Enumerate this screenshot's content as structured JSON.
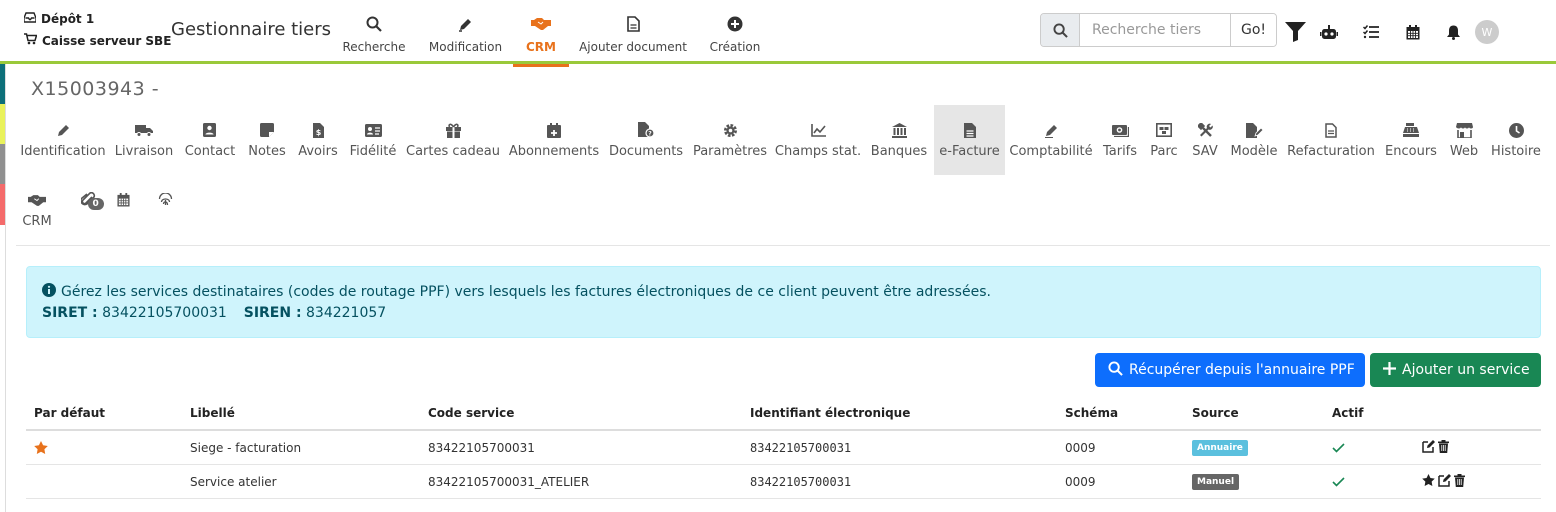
{
  "header": {
    "depot": "Dépôt 1",
    "caisse": "Caisse serveur SBE",
    "app_title": "Gestionnaire tiers",
    "nav": [
      {
        "label": "Recherche",
        "icon": "search-icon"
      },
      {
        "label": "Modification",
        "icon": "pencil-icon"
      },
      {
        "label": "CRM",
        "icon": "handshake-icon",
        "active": true
      },
      {
        "label": "Ajouter document",
        "icon": "file-icon"
      },
      {
        "label": "Création",
        "icon": "plus-circle-icon"
      }
    ],
    "search": {
      "placeholder": "Recherche tiers",
      "go_label": "Go!"
    },
    "avatar_initial": "W"
  },
  "colors": {
    "accent": "#e8721c",
    "topbar_border": "#9ac93a",
    "primary": "#0d6efd",
    "success": "#198754",
    "info_bg": "#cff4fc"
  },
  "record": {
    "title": "X15003943 -"
  },
  "tabs": [
    {
      "label": "Identification",
      "icon": "pencil-icon"
    },
    {
      "label": "Livraison",
      "icon": "truck-icon"
    },
    {
      "label": "Contact",
      "icon": "contact-card-icon"
    },
    {
      "label": "Notes",
      "icon": "sticky-note-icon"
    },
    {
      "label": "Avoirs",
      "icon": "invoice-dollar-icon"
    },
    {
      "label": "Fidélité",
      "icon": "id-card-icon"
    },
    {
      "label": "Cartes cadeau",
      "icon": "gift-icon"
    },
    {
      "label": "Abonnements",
      "icon": "calendar-plus-icon"
    },
    {
      "label": "Documents",
      "icon": "file-search-icon"
    },
    {
      "label": "Paramètres",
      "icon": "gear-icon"
    },
    {
      "label": "Champs stat.",
      "icon": "line-chart-icon"
    },
    {
      "label": "Banques",
      "icon": "bank-icon"
    },
    {
      "label": "e-Facture",
      "icon": "file-lines-icon",
      "active": true
    },
    {
      "label": "Comptabilité",
      "icon": "pen-icon"
    },
    {
      "label": "Tarifs",
      "icon": "money-icon"
    },
    {
      "label": "Parc",
      "icon": "warehouse-icon"
    },
    {
      "label": "SAV",
      "icon": "tools-icon"
    },
    {
      "label": "Modèle",
      "icon": "file-pen-icon"
    },
    {
      "label": "Refacturation",
      "icon": "file-invoice-icon"
    },
    {
      "label": "Encours",
      "icon": "cash-register-icon"
    },
    {
      "label": "Web",
      "icon": "store-icon"
    },
    {
      "label": "Histoire",
      "icon": "clock-icon"
    },
    {
      "label": "CRM",
      "icon": "handshake-icon"
    },
    {
      "label": "",
      "icon": "paperclip-icon",
      "badge": "0"
    },
    {
      "label": "",
      "icon": "calendar-icon"
    },
    {
      "label": "",
      "icon": "fingerprint-icon"
    }
  ],
  "info": {
    "message": "Gérez les services destinataires (codes de routage PPF) vers lesquels les factures électroniques de ce client peuvent être adressées.",
    "siret_label": "SIRET :",
    "siret_value": "83422105700031",
    "siren_label": "SIREN :",
    "siren_value": "834221057"
  },
  "actions": {
    "fetch_label": "Récupérer depuis l'annuaire PPF",
    "add_label": "Ajouter un service"
  },
  "table": {
    "headers": [
      "Par défaut",
      "Libellé",
      "Code service",
      "Identifiant électronique",
      "Schéma",
      "Source",
      "Actif"
    ],
    "rows": [
      {
        "default": true,
        "libelle": "Siege - facturation",
        "code": "83422105700031",
        "identifiant": "83422105700031",
        "schema": "0009",
        "source": "Annuaire",
        "actif": true
      },
      {
        "default": false,
        "libelle": "Service atelier",
        "code": "83422105700031_ATELIER",
        "identifiant": "83422105700031",
        "schema": "0009",
        "source": "Manuel",
        "actif": true
      }
    ]
  }
}
